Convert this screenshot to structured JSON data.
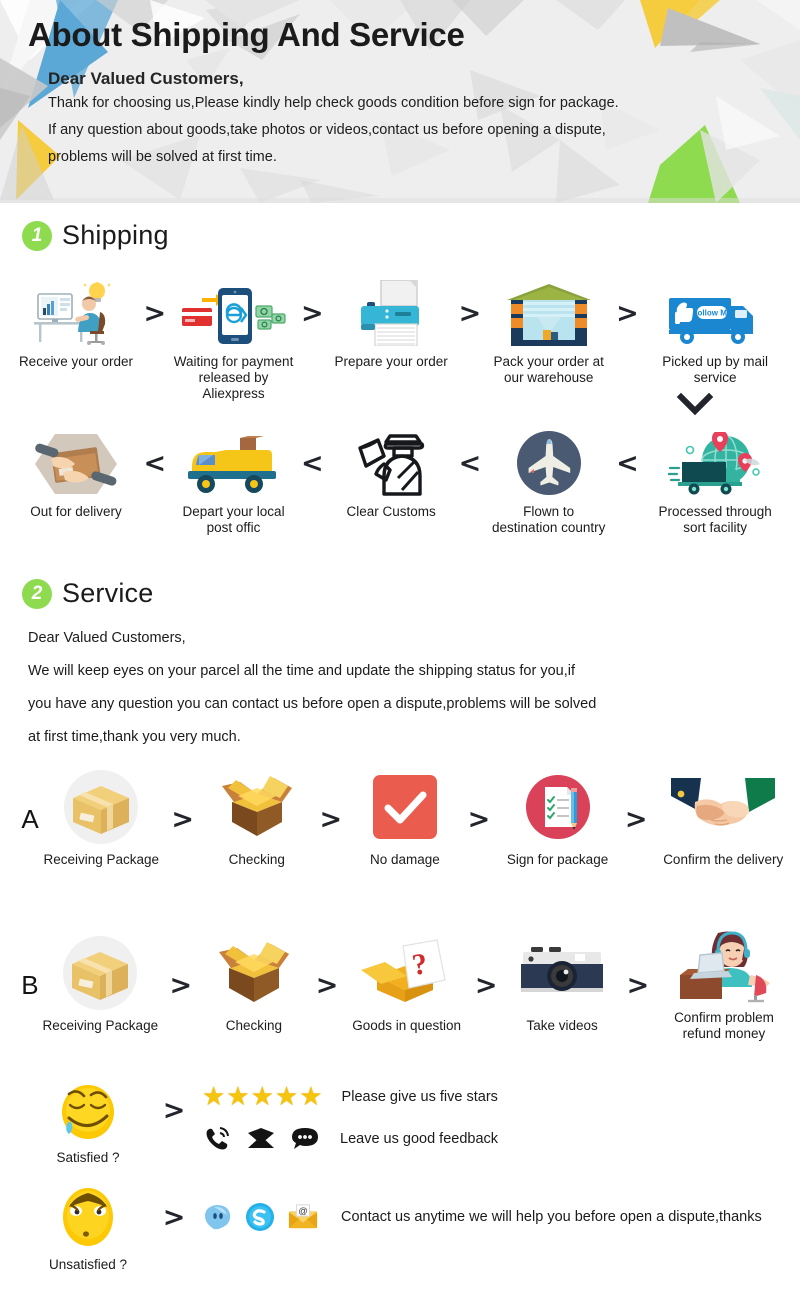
{
  "header": {
    "title": "About Shipping And Service",
    "subtitle": "Dear Valued Customers,",
    "lines": [
      "Thank for choosing us,Please kindly help check goods condition before sign for package.",
      "If any question about goods,take photos or videos,contact us before opening a dispute,",
      "problems will be solved at first time."
    ],
    "bg_color": "#eeeeee",
    "accent_blue": "#5ba7d6",
    "accent_yellow": "#f5cc3e",
    "accent_green": "#8fdb4f",
    "accent_gray": "#bdbdbd"
  },
  "sections": [
    {
      "number": "1",
      "title": "Shipping",
      "badge_color": "#8fdb4f"
    },
    {
      "number": "2",
      "title": "Service",
      "badge_color": "#8fdb4f"
    }
  ],
  "shipping": {
    "row1_chevron": ">",
    "row2_chevron": "<",
    "turn_chevron": "v",
    "row1": [
      {
        "icon": "person-at-desk-computer-icon",
        "caption": "Receive your order"
      },
      {
        "icon": "mobile-payment-cash-icon",
        "caption": "Waiting for payment\nreleased by Aliexpress"
      },
      {
        "icon": "printer-icon",
        "caption": "Prepare your order"
      },
      {
        "icon": "warehouse-icon",
        "caption": "Pack your order at\nour warehouse"
      },
      {
        "icon": "delivery-truck-follow-me-icon",
        "caption": "Picked up by mail service"
      }
    ],
    "row2": [
      {
        "icon": "hands-packing-box-icon",
        "caption": "Out for delivery"
      },
      {
        "icon": "yellow-van-parcels-icon",
        "caption": "Depart your local\npost offic"
      },
      {
        "icon": "customs-officer-icon",
        "caption": "Clear Customs"
      },
      {
        "icon": "airplane-circle-icon",
        "caption": "Flown to\ndestination country"
      },
      {
        "icon": "globe-truck-sort-facility-icon",
        "caption": "Processed through\nsort facility"
      }
    ]
  },
  "service": {
    "greeting": "Dear Valued Customers,",
    "paragraph": [
      "We will keep eyes on your parcel all the time and update the shipping status for you,if",
      "you have any question you can contact us before open a dispute,problems will be solved",
      "at first time,thank you very much."
    ],
    "chevron": ">",
    "rowA": {
      "letter": "A",
      "steps": [
        {
          "icon": "closed-carton-box-icon",
          "caption": "Receiving Package"
        },
        {
          "icon": "open-carton-box-icon",
          "caption": "Checking"
        },
        {
          "icon": "red-checkmark-icon",
          "caption": "No damage"
        },
        {
          "icon": "sign-document-checklist-icon",
          "caption": "Sign for package"
        },
        {
          "icon": "handshake-icon",
          "caption": "Confirm the delivery"
        }
      ]
    },
    "rowB": {
      "letter": "B",
      "steps": [
        {
          "icon": "closed-carton-box-icon",
          "caption": "Receiving Package"
        },
        {
          "icon": "open-carton-box-icon",
          "caption": "Checking"
        },
        {
          "icon": "question-mark-box-icon",
          "caption": "Goods in question"
        },
        {
          "icon": "camera-icon",
          "caption": "Take videos"
        },
        {
          "icon": "customer-service-agent-icon",
          "caption": "Confirm problem\nrefund money"
        }
      ]
    },
    "feedback": {
      "face_icon": "satisfied-smiley-icon",
      "face_caption": "Satisfied ?",
      "stars": "★★★★★",
      "star_count": 5,
      "star_color": "#f5c40f",
      "stars_text": "Please give us five stars",
      "contact_icons": [
        "phone-ring-icon",
        "envelope-icon",
        "chat-bubble-icon"
      ],
      "contact_text": "Leave us good feedback"
    },
    "unsatisfied": {
      "face_icon": "unsatisfied-smiley-icon",
      "face_caption": "Unsatisfied ?",
      "chat_icons": [
        "aliexpress-messenger-icon",
        "skype-icon",
        "email-at-icon"
      ],
      "text": "Contact us anytime we will help you before open a dispute,thanks"
    }
  }
}
